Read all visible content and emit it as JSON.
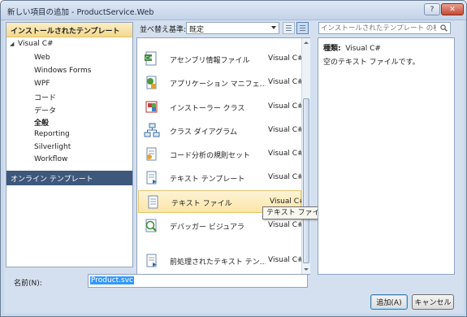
{
  "window": {
    "title": "新しい項目の追加 - ProductService.Web",
    "help_label": "?",
    "close_label": "✕"
  },
  "left_panel": {
    "header": "インストールされたテンプレート",
    "root": "Visual C#",
    "items": [
      {
        "label": "Web"
      },
      {
        "label": "Windows Forms"
      },
      {
        "label": "WPF"
      },
      {
        "label": "コード"
      },
      {
        "label": "データ"
      },
      {
        "label": "全般",
        "selected": true
      },
      {
        "label": "Reporting"
      },
      {
        "label": "Silverlight"
      },
      {
        "label": "Workflow"
      }
    ],
    "online": "オンライン テンプレート"
  },
  "toolbar": {
    "sort_label": "並べ替え基準:",
    "sort_value": "既定",
    "search_placeholder": "インストールされたテンプレート の検索"
  },
  "templates": [
    {
      "name": "アセンブリ情報ファイル",
      "lang": "Visual C#",
      "icon": "assembly-info-icon"
    },
    {
      "name": "アプリケーション マニフェ…",
      "lang": "Visual C#",
      "icon": "app-manifest-icon"
    },
    {
      "name": "インストーラー クラス",
      "lang": "Visual C#",
      "icon": "installer-class-icon"
    },
    {
      "name": "クラス ダイアグラム",
      "lang": "Visual C#",
      "icon": "class-diagram-icon"
    },
    {
      "name": "コード分析の規則セット",
      "lang": "Visual C#",
      "icon": "code-analysis-icon"
    },
    {
      "name": "テキスト テンプレート",
      "lang": "Visual C#",
      "icon": "text-template-icon"
    },
    {
      "name": "テキスト ファイル",
      "lang": "Visual C#",
      "icon": "text-file-icon",
      "selected": true
    },
    {
      "name": "デバッガー ビジュアラ",
      "lang": "Visual C#",
      "icon": "debugger-visualizer-icon"
    },
    {
      "name": "前処理されたテキスト テン…",
      "lang": "Visual C#",
      "icon": "preprocessed-template-icon"
    }
  ],
  "tooltip": "テキスト ファイル",
  "details": {
    "type_label": "種類:",
    "type_value": "Visual C#",
    "description": "空のテキスト ファイルです。"
  },
  "bottom": {
    "name_label": "名前(N):",
    "name_value": "Product.svc",
    "add_label": "追加(A)",
    "cancel_label": "キャンセル"
  },
  "colors": {
    "selection": "#fbe6a7",
    "online_bar": "#3e587c",
    "header": "#f4d98e"
  }
}
